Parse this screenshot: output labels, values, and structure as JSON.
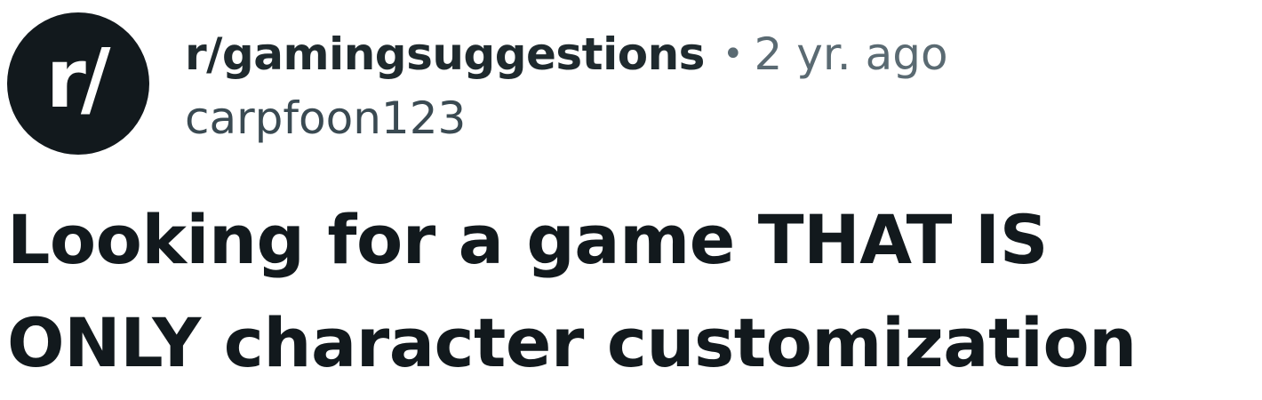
{
  "post": {
    "subreddit_icon_text": "r/",
    "subreddit": "r/gamingsuggestions",
    "separator": "•",
    "age": "2 yr. ago",
    "author": "carpfoon123",
    "title": "Looking for a game THAT IS ONLY character customization"
  },
  "colors": {
    "text_primary": "#12191d",
    "text_secondary": "#5a6a72",
    "avatar_bg": "#12191d",
    "background": "#ffffff"
  }
}
